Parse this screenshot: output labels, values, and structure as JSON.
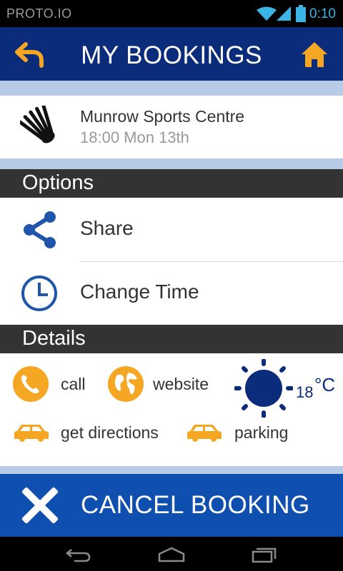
{
  "status_bar": {
    "brand": "PROTO.IO",
    "time": "0:10"
  },
  "header": {
    "title": "MY BOOKINGS",
    "back_icon": "back-arrow-icon",
    "home_icon": "home-icon"
  },
  "booking": {
    "venue": "Munrow Sports Centre",
    "when": "18:00 Mon 13th",
    "icon": "shuttlecock-icon"
  },
  "options": {
    "heading": "Options",
    "items": [
      {
        "label": "Share",
        "icon": "share-icon"
      },
      {
        "label": "Change Time",
        "icon": "clock-icon"
      }
    ]
  },
  "details": {
    "heading": "Details",
    "call_label": "call",
    "website_label": "website",
    "directions_label": "get directions",
    "parking_label": "parking",
    "weather": {
      "temperature": "18",
      "unit": "°C",
      "icon": "sun-icon"
    }
  },
  "cancel": {
    "label": "CANCEL BOOKING",
    "icon": "close-icon"
  },
  "colors": {
    "header": "#0a2c7a",
    "accent": "#f5a623",
    "cancel": "#0f4fb0",
    "band": "#b8cbe6",
    "section": "#333333",
    "icon_blue": "#1f55aa"
  }
}
